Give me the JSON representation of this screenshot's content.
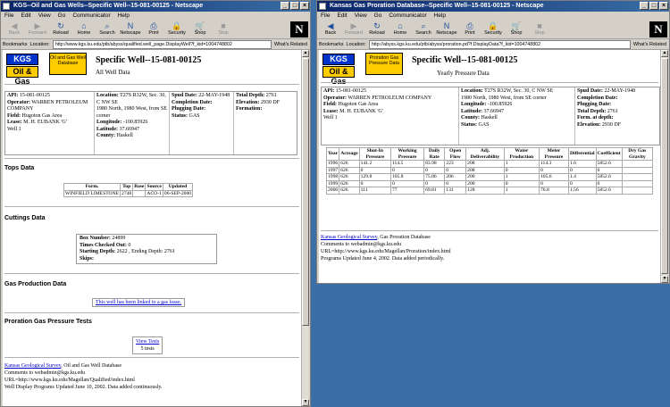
{
  "win1": {
    "title": "KGS--Oil and Gas Wells--Specific Well--15-081-00125 - Netscape",
    "menu": [
      "File",
      "Edit",
      "View",
      "Go",
      "Communicator",
      "Help"
    ],
    "toolbar": [
      {
        "label": "Back",
        "icon": "back-arrow-icon",
        "disabled": true
      },
      {
        "label": "Forward",
        "icon": "forward-arrow-icon",
        "disabled": true
      },
      {
        "label": "Reload",
        "icon": "reload-icon",
        "disabled": false
      },
      {
        "label": "Home",
        "icon": "home-icon",
        "disabled": false
      },
      {
        "label": "Search",
        "icon": "search-icon",
        "disabled": false
      },
      {
        "label": "Netscape",
        "icon": "netscape-icon",
        "disabled": false
      },
      {
        "label": "Print",
        "icon": "print-icon",
        "disabled": false
      },
      {
        "label": "Security",
        "icon": "lock-icon",
        "disabled": false
      },
      {
        "label": "Shop",
        "icon": "shop-icon",
        "disabled": false
      },
      {
        "label": "Stop",
        "icon": "stop-icon",
        "disabled": true
      }
    ],
    "bookmarks_label": "Bookmarks",
    "location_label": "Location:",
    "url": "http://www.kgs.ku.edu/ptb/abyss/qualified.well_page.DisplayWell?f_kid=1004748802",
    "whats_related": "What's Related",
    "header": {
      "kgs": "KGS",
      "oilgas": "Oil & Gas",
      "ybox": "Oil and Gas Well Database",
      "title": "Specific Well--15-081-00125",
      "subtitle": "All Well Data"
    },
    "info": {
      "c1": [
        [
          "API:",
          "15-081-00125"
        ],
        [
          "Operator:",
          "WARREN PETROLEUM COMPANY"
        ],
        [
          "Field:",
          "Hugoton Gas Area"
        ],
        [
          "Lease:",
          "M. H. EUBANK 'G'"
        ],
        [
          "",
          "Well 1"
        ]
      ],
      "c2": [
        [
          "Location:",
          "T27S R32W, Sec. 30, C NW SE"
        ],
        [
          "",
          "1980 North, 1980 West, from SE corner"
        ],
        [
          "Longitude:",
          "-100.85926"
        ],
        [
          "Latitude:",
          "37.66947"
        ],
        [
          "County:",
          "Haskell"
        ]
      ],
      "c3": [
        [
          "Spud Date:",
          "22-MAY-1948"
        ],
        [
          "Completion Date:",
          ""
        ],
        [
          "Plugging Date:",
          ""
        ],
        [
          "Status:",
          "GAS"
        ]
      ],
      "c4": [
        [
          "Total Depth:",
          "2761"
        ],
        [
          "Elevation:",
          "2930 DF"
        ],
        [
          "Formation:",
          ""
        ]
      ]
    },
    "tops_title": "Tops Data",
    "tops": {
      "headers": [
        "Form.",
        "Top",
        "Base",
        "Source",
        "Updated"
      ],
      "rows": [
        [
          "WINFIELD LIMESTONE",
          "2748",
          "",
          "ACO-1",
          "06-SEP-2000"
        ]
      ]
    },
    "cuttings_title": "Cuttings Data",
    "cuttings": [
      [
        "Box Number:",
        "24899"
      ],
      [
        "Times Checked Out:",
        "0"
      ],
      [
        "Starting Depth:",
        "2622 , Ending Depth: 2761"
      ],
      [
        "Skips:",
        ""
      ]
    ],
    "gasprod_title": "Gas Production Data",
    "gas_link": "This well has been linked to a gas lease.",
    "proration_title": "Proration Gas Pressure Tests",
    "view_tests": "View Tests",
    "tests_count": "5 tests",
    "footer": {
      "kgs_link": "Kansas Geological Survey",
      "kgs_rest": ", Oil and Gas Well Database",
      "lines": [
        "Comments to webadmin@kgs.ku.edu",
        "URL=http://www.kgs.ku.edu/Magellan/Qualified/index.html",
        "Well Display Programs Updated June 10, 2002. Data added continuously."
      ]
    }
  },
  "win2": {
    "title": "Kansas Gas Proration Database--Specific Well--15-081-00125 - Netscape",
    "menu": [
      "File",
      "Edit",
      "View",
      "Go",
      "Communicator",
      "Help"
    ],
    "toolbar": [
      {
        "label": "Back",
        "icon": "back-arrow-icon",
        "disabled": false
      },
      {
        "label": "Forward",
        "icon": "forward-arrow-icon",
        "disabled": true
      },
      {
        "label": "Reload",
        "icon": "reload-icon",
        "disabled": false
      },
      {
        "label": "Home",
        "icon": "home-icon",
        "disabled": false
      },
      {
        "label": "Search",
        "icon": "search-icon",
        "disabled": false
      },
      {
        "label": "Netscape",
        "icon": "netscape-icon",
        "disabled": false
      },
      {
        "label": "Print",
        "icon": "print-icon",
        "disabled": false
      },
      {
        "label": "Security",
        "icon": "lock-icon",
        "disabled": false
      },
      {
        "label": "Shop",
        "icon": "shop-icon",
        "disabled": false
      },
      {
        "label": "Stop",
        "icon": "stop-icon",
        "disabled": true
      }
    ],
    "bookmarks_label": "Bookmarks",
    "location_label": "Location:",
    "url": "http://abyss.kgs.ku.edu/ptb/abyss/proration.pd?f.DisplayData?f_kid=1004748802",
    "whats_related": "What's Related",
    "header": {
      "kgs": "KGS",
      "oilgas": "Oil & Gas",
      "ybox": "Proration Gas Pressure Data",
      "title": "Specific Well--15-081-00125",
      "subtitle": "Yearly Pressure Data"
    },
    "info": {
      "c1": [
        [
          "API:",
          "15-081-00125"
        ],
        [
          "Operator:",
          "WARREN PETROLEUM COMPANY"
        ],
        [
          "Field:",
          "Hugoton Gas Area"
        ],
        [
          "Lease:",
          "M. H. EUBANK 'G'"
        ],
        [
          "",
          "Well 1"
        ]
      ],
      "c2": [
        [
          "Location:",
          "T27S R32W, Sec. 30, C NW SE"
        ],
        [
          "",
          "1980 North, 1980 West, from SE corner"
        ],
        [
          "Longitude:",
          "-100.85926"
        ],
        [
          "Latitude:",
          "37.66947"
        ],
        [
          "County:",
          "Haskell"
        ],
        [
          "Status:",
          "GAS"
        ]
      ],
      "c3": [
        [
          "Spud Date:",
          "22-MAY-1948"
        ],
        [
          "Completion Date:",
          ""
        ],
        [
          "Plugging Date:",
          ""
        ],
        [
          "Total Depth:",
          "2761"
        ],
        [
          "Form. at depth:",
          ""
        ],
        [
          "Elevation:",
          "2930 DF"
        ]
      ]
    },
    "pressure": {
      "headers": [
        "Year",
        "Acreage",
        "Shut-In Pressure",
        "Working Pressure",
        "Daily Rate",
        "Open Flow",
        "Adj. Deliverability",
        "Water Production",
        "Meter Pressure",
        "Differential",
        "Coefficient",
        "Dry Gas Gravity"
      ],
      "rows": [
        [
          "1996",
          "626",
          "141.2",
          "114.5",
          "83.98",
          "223",
          "208",
          "1",
          "114.3",
          "1.6",
          "5852.6",
          ""
        ],
        [
          "1997",
          "626",
          "0",
          "0",
          "0",
          "0",
          "208",
          "0",
          "0",
          "0",
          "0",
          ""
        ],
        [
          "1998",
          "626",
          "129.8",
          "105.8",
          "75.86",
          "206",
          "200",
          "1",
          "105.6",
          "1.4",
          "5852.6",
          ""
        ],
        [
          "1999",
          "626",
          "0",
          "0",
          "0",
          "0",
          "200",
          "0",
          "0",
          "0",
          "0",
          ""
        ],
        [
          "2000",
          "626",
          "111",
          "77",
          "69.81",
          "131",
          "128",
          "1",
          "76.8",
          "1.56",
          "5852.6",
          ""
        ]
      ]
    },
    "footer": {
      "kgs_link": "Kansas Geological Survey",
      "kgs_rest": ", Gas Proration Database",
      "lines": [
        "Comments to webadmin@kgs.ku.edu",
        "URL=http://www.kgs.ku.edu/Magellan/Proration/index.html",
        "Programs Updated June 4, 2002. Data added periodically."
      ]
    }
  }
}
